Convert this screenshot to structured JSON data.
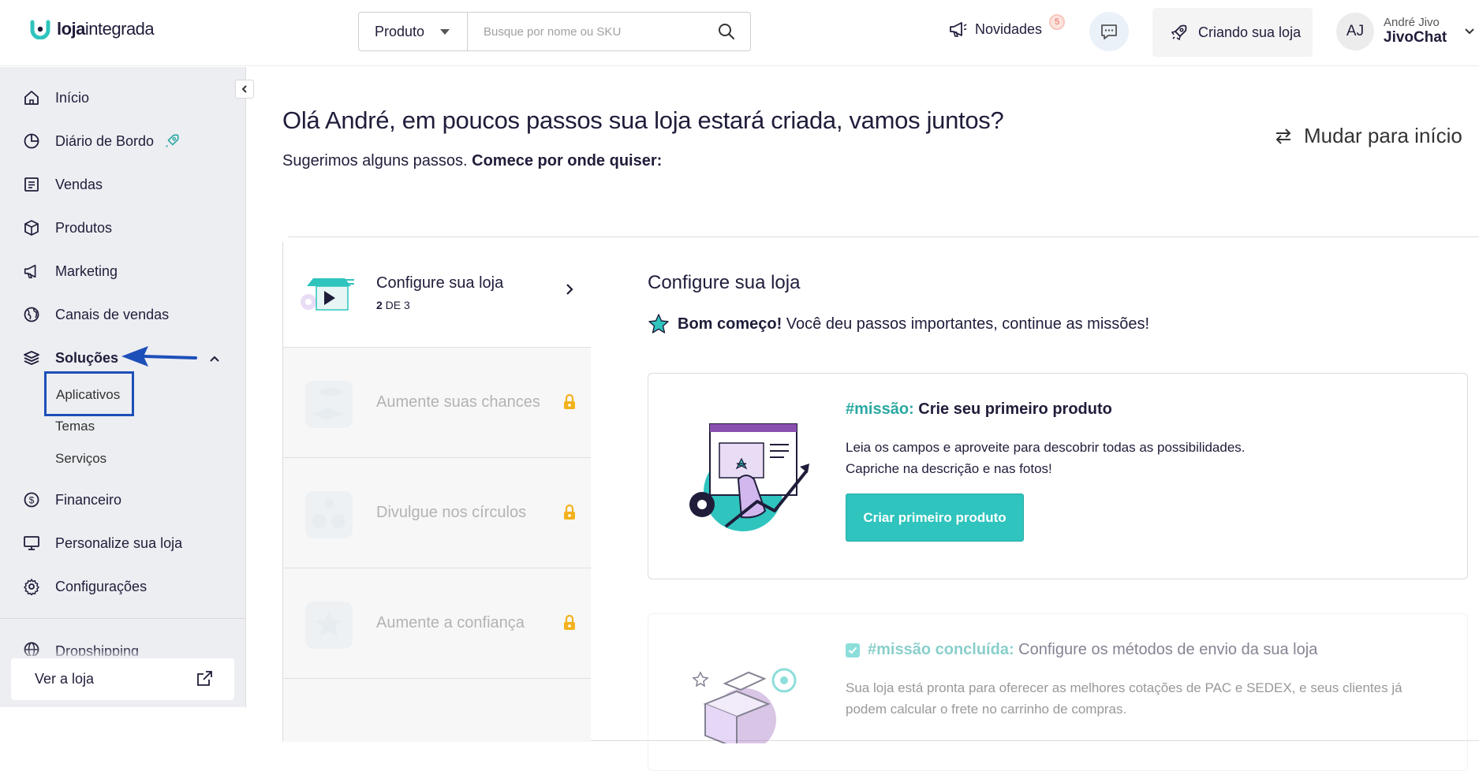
{
  "header": {
    "logo_text_bold": "loja",
    "logo_text_rest": "integrada",
    "search_type_selected": "Produto",
    "search_placeholder": "Busque por nome ou SKU",
    "novidades_label": "Novidades",
    "novidades_count": "5",
    "criando_label": "Criando sua loja",
    "user_initials": "AJ",
    "user_name": "André Jivo",
    "user_store": "JivoChat"
  },
  "sidebar": {
    "items": [
      {
        "label": "Início",
        "icon": "home-icon"
      },
      {
        "label": "Diário de Bordo",
        "icon": "chart-pie-icon"
      },
      {
        "label": "Vendas",
        "icon": "receipt-icon"
      },
      {
        "label": "Produtos",
        "icon": "box-icon"
      },
      {
        "label": "Marketing",
        "icon": "megaphone-icon"
      },
      {
        "label": "Canais de vendas",
        "icon": "globe-icon"
      },
      {
        "label": "Soluções",
        "icon": "layers-icon"
      },
      {
        "label": "Financeiro",
        "icon": "dollar-icon"
      },
      {
        "label": "Personalize sua loja",
        "icon": "monitor-icon"
      },
      {
        "label": "Configurações",
        "icon": "gear-icon"
      },
      {
        "label": "Dropshipping",
        "icon": "globe-icon"
      }
    ],
    "sub_items": [
      "Aplicativos",
      "Temas",
      "Serviços"
    ],
    "ver_loja": "Ver a loja"
  },
  "main": {
    "greeting": "Olá André, em poucos passos sua loja estará criada, vamos juntos?",
    "sub_normal": "Sugerimos alguns passos. ",
    "sub_bold": "Comece por onde quiser:",
    "mudar_label": "Mudar para início",
    "steps": [
      {
        "title": "Configure sua loja",
        "progress_bold": "2",
        "progress_rest": " DE 3"
      },
      {
        "title": "Aumente suas chances"
      },
      {
        "title": "Divulgue nos círculos"
      },
      {
        "title": "Aumente a confiança"
      }
    ],
    "content_title": "Configure sua loja",
    "bom_bold": "Bom começo!",
    "bom_rest": " Você deu passos importantes, continue as missões!",
    "mission1": {
      "tag": "#missão:",
      "title": " Crie seu primeiro produto",
      "desc1": "Leia os campos e aproveite para descobrir todas as possibilidades.",
      "desc2": "Capriche na descrição e nas fotos!",
      "button": "Criar primeiro produto"
    },
    "mission2": {
      "tag": "#missão concluída:",
      "title": " Configure os métodos de envio da sua loja",
      "desc": "Sua loja está pronta para oferecer as melhores cotações de PAC e SEDEX, e seus clientes já podem calcular o frete no carrinho de compras."
    }
  },
  "colors": {
    "accent": "#2fc4be",
    "highlight_box": "#1d4fb8",
    "text": "#1f1d3a"
  }
}
